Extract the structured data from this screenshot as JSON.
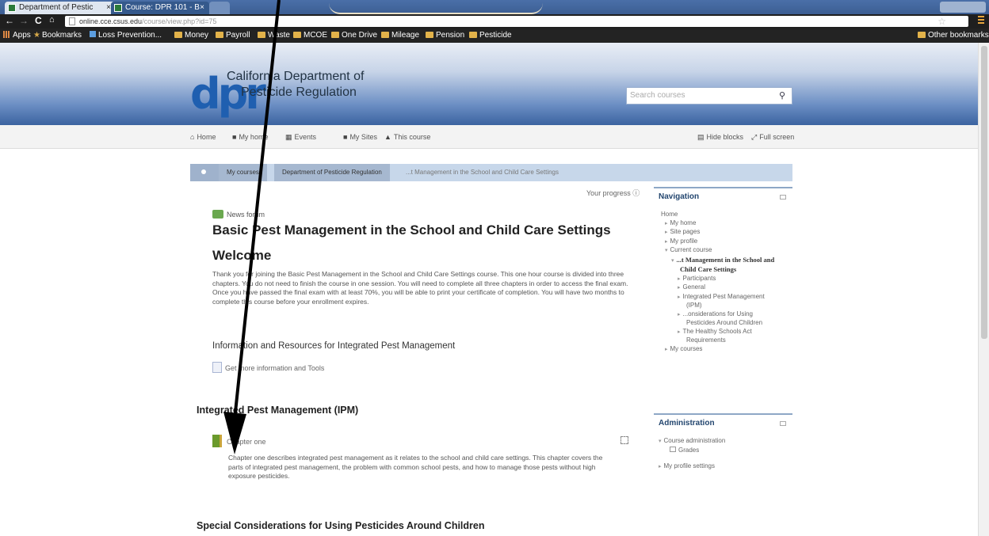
{
  "browser": {
    "tabs": [
      {
        "label": "Department of Pestic"
      },
      {
        "label": "Course: DPR 101 - B"
      }
    ],
    "url": {
      "host": "online.cce.csus.edu",
      "path": "/course/view.php?id=75"
    },
    "bookmarks": [
      {
        "label": "Apps"
      },
      {
        "label": "Bookmarks"
      },
      {
        "label": "Loss Prevention..."
      },
      {
        "label": "Money"
      },
      {
        "label": "Payroll"
      },
      {
        "label": "Waste"
      },
      {
        "label": "MCOE"
      },
      {
        "label": "One Drive"
      },
      {
        "label": "Mileage"
      },
      {
        "label": "Pension"
      },
      {
        "label": "Pesticide"
      }
    ],
    "other_bookmarks": "Other bookmarks"
  },
  "header": {
    "logo_letters": "dpr",
    "logo_line1": "California Department of",
    "logo_line2": "Pesticide Regulation",
    "search_placeholder": "Search courses"
  },
  "topnav": {
    "home": "Home",
    "my_home": "My home",
    "events": "Events",
    "my_sites": "My Sites",
    "this_course": "This course",
    "hide_blocks": "Hide blocks",
    "full_screen": "Full screen"
  },
  "breadcrumb": {
    "items": [
      "My courses",
      "Department of Pesticide Regulation",
      "...t Management in the School and Child Care Settings"
    ]
  },
  "main": {
    "progress": "Your progress",
    "news_forum": "News forum",
    "course_title": "Basic Pest Management in the School and Child Care Settings",
    "welcome": "Welcome",
    "intro": "Thank you for joining the Basic Pest Management in the School and Child Care Settings course. This one hour course is divided into three chapters. You do not need to finish the course in one session. You will need to complete all three chapters in order to access the final exam. Once you have passed the final exam with at least 70%, you will be able to print your certificate of completion. You will have two months to complete this course before your enrollment expires.",
    "info_heading": "Information and Resources for Integrated Pest Management",
    "info_link": "Get more information and Tools",
    "ipm_heading": "Integrated Pest Management (IPM)",
    "chapter_link": "Chapter one",
    "chapter_desc": "Chapter one describes integrated pest management as it relates to the school and child care settings. This chapter covers the parts of integrated pest management, the problem with common school pests, and how to manage those pests without high exposure pesticides.",
    "special_heading": "Special Considerations for Using Pesticides Around Children"
  },
  "navigation": {
    "title": "Navigation",
    "items": [
      {
        "label": "Home",
        "indent": 0,
        "arrow": ""
      },
      {
        "label": "My home",
        "indent": 1,
        "arrow": "▸"
      },
      {
        "label": "Site pages",
        "indent": 1,
        "arrow": "▸"
      },
      {
        "label": "My profile",
        "indent": 1,
        "arrow": "▸"
      },
      {
        "label": "Current course",
        "indent": 1,
        "arrow": "▾"
      },
      {
        "label": "...t Management in the School and",
        "indent": 2,
        "arrow": "▾",
        "bold": true
      },
      {
        "label": "Child Care Settings",
        "indent": 3,
        "arrow": "",
        "bold": true
      },
      {
        "label": "Participants",
        "indent": 3,
        "arrow": "▸"
      },
      {
        "label": "General",
        "indent": 3,
        "arrow": "▸"
      },
      {
        "label": "Integrated Pest Management",
        "indent": 3,
        "arrow": "▸"
      },
      {
        "label": "(IPM)",
        "indent": 4,
        "arrow": ""
      },
      {
        "label": "...onsiderations for Using",
        "indent": 3,
        "arrow": "▸"
      },
      {
        "label": "Pesticides Around Children",
        "indent": 4,
        "arrow": ""
      },
      {
        "label": "The Healthy Schools Act",
        "indent": 3,
        "arrow": "▸"
      },
      {
        "label": "Requirements",
        "indent": 4,
        "arrow": ""
      },
      {
        "label": "My courses",
        "indent": 1,
        "arrow": "▸"
      }
    ]
  },
  "administration": {
    "title": "Administration",
    "course_admin": "Course administration",
    "grades": "Grades",
    "profile_settings": "My profile settings"
  },
  "colors": {
    "header_blue": "#3b63a0",
    "link_blue": "#23466f",
    "annotation": "#000000"
  }
}
